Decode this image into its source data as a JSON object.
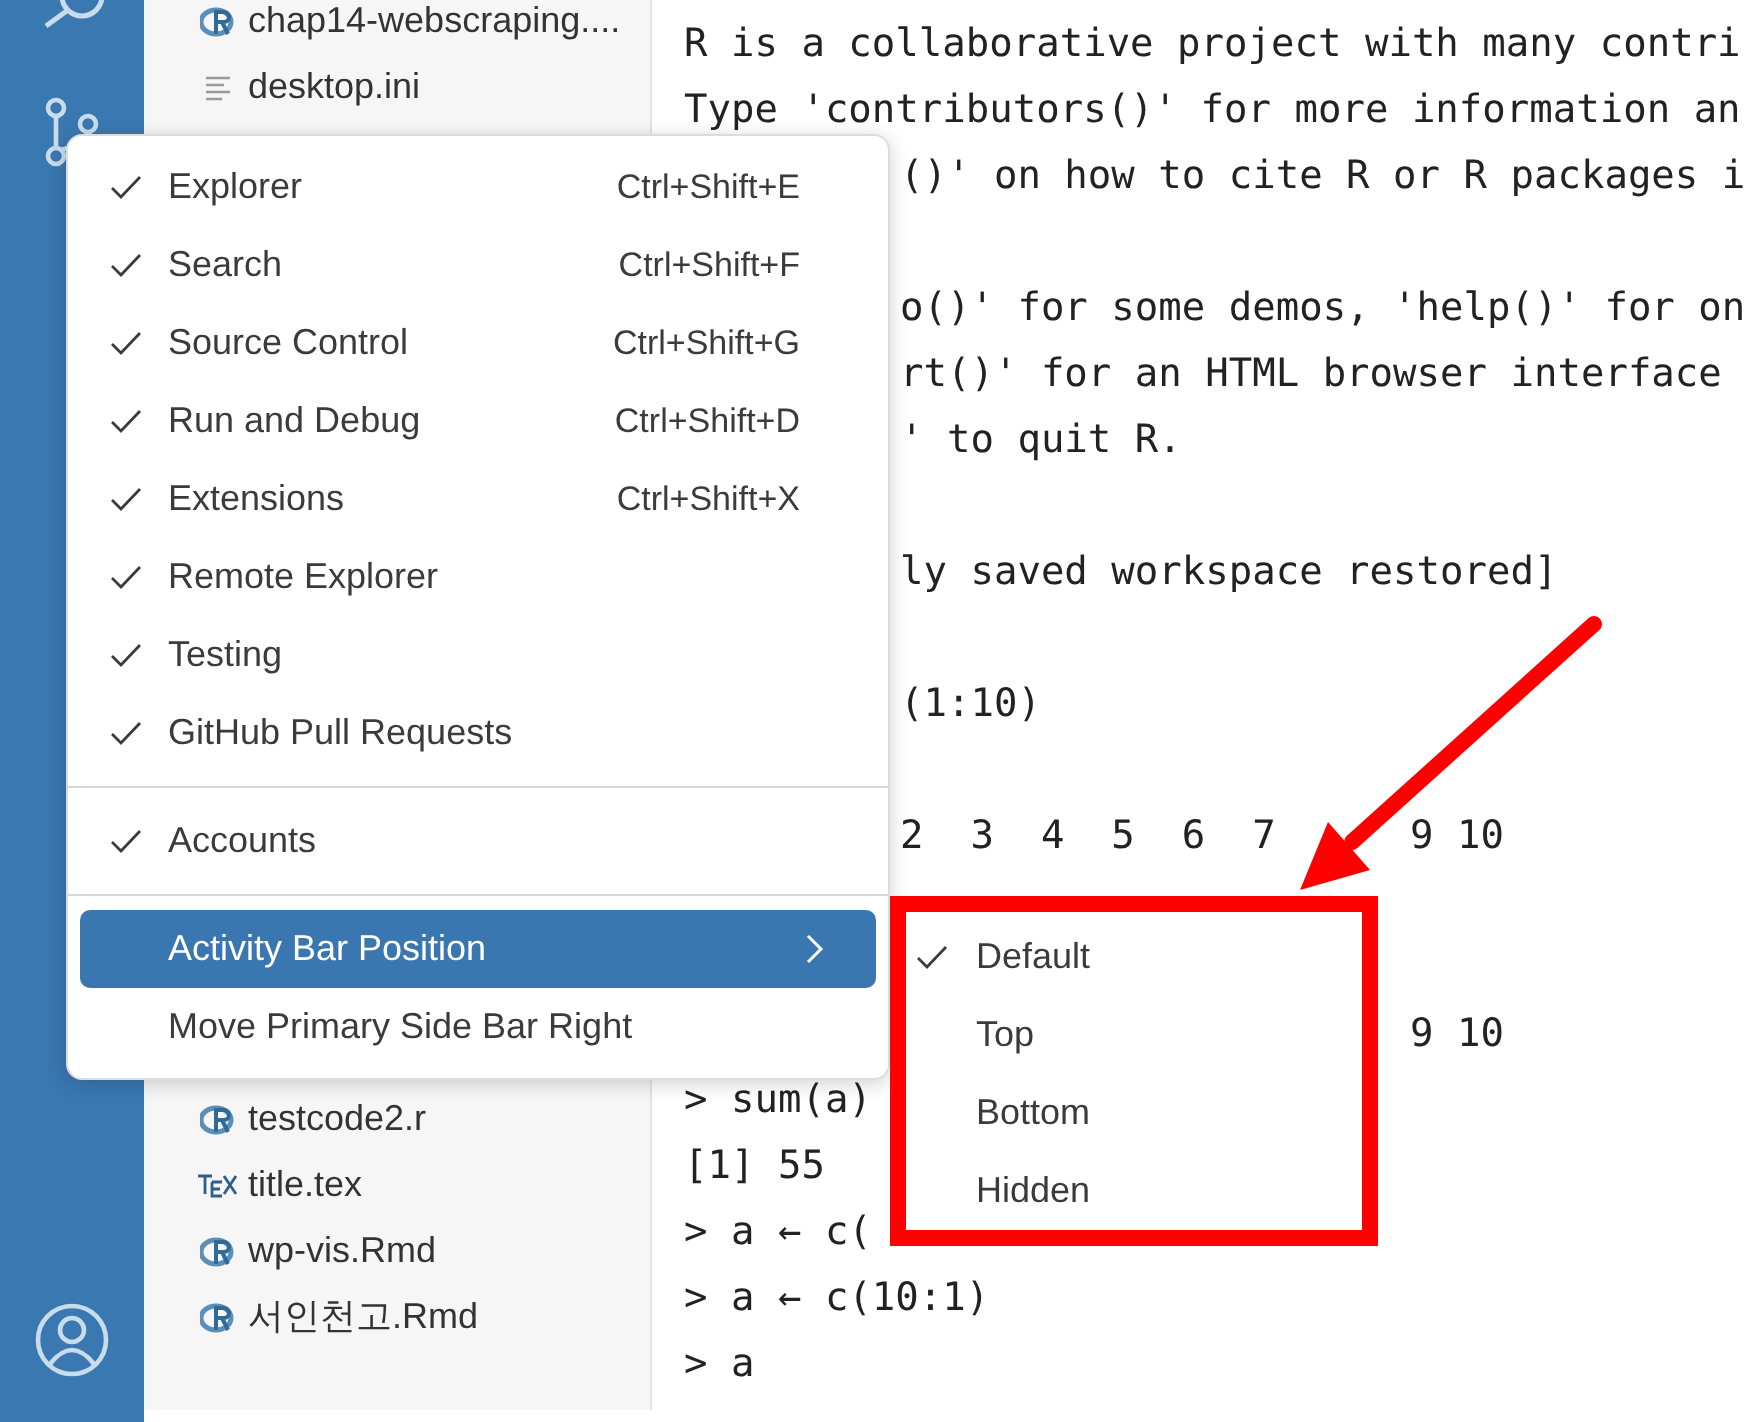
{
  "explorer": {
    "top_files": [
      {
        "name": "chap14-webscraping....",
        "kind": "r"
      },
      {
        "name": "desktop.ini",
        "kind": "text"
      }
    ],
    "bottom_files": [
      {
        "name": "testcode2.r",
        "kind": "r"
      },
      {
        "name": "title.tex",
        "kind": "tex"
      },
      {
        "name": "wp-vis.Rmd",
        "kind": "r"
      },
      {
        "name": "서인천고.Rmd",
        "kind": "r"
      }
    ]
  },
  "terminal": {
    "blocks": [
      [
        {
          "text": "R is a collaborative project with many contri",
          "kind": "full"
        },
        {
          "text": "Type 'contributors()' for more information an",
          "kind": "full"
        },
        {
          "text": "()' on how to cite R or R packages i",
          "kind": "clipped"
        }
      ],
      [
        {
          "text": "o()' for some demos, 'help()' for on",
          "kind": "clipped"
        },
        {
          "text": "rt()' for an HTML browser interface",
          "kind": "clipped"
        },
        {
          "text": "' to quit R.",
          "kind": "clipped"
        }
      ],
      [
        {
          "text": "ly saved workspace restored]",
          "kind": "clipped"
        }
      ],
      [
        {
          "text": "(1:10)",
          "kind": "clipped"
        }
      ],
      [
        {
          "text": "2  3  4  5  6  7",
          "text_right": "9 10",
          "kind": "clipped"
        },
        {
          "text": "9 10",
          "kind": "beside_submenu"
        },
        {
          "text": "> sum(a)",
          "kind": "full"
        },
        {
          "text": "[1] 55",
          "kind": "full"
        },
        {
          "text": "> a ← c(",
          "kind": "full"
        },
        {
          "text": "> a ← c(10:1)",
          "kind": "full"
        },
        {
          "text": "> a",
          "kind": "full"
        }
      ]
    ]
  },
  "context_menu": {
    "groups": [
      [
        {
          "label": "Explorer",
          "shortcut": "Ctrl+Shift+E",
          "checked": true,
          "selected": false
        },
        {
          "label": "Search",
          "shortcut": "Ctrl+Shift+F",
          "checked": true,
          "selected": false
        },
        {
          "label": "Source Control",
          "shortcut": "Ctrl+Shift+G",
          "checked": true,
          "selected": false
        },
        {
          "label": "Run and Debug",
          "shortcut": "Ctrl+Shift+D",
          "checked": true,
          "selected": false
        },
        {
          "label": "Extensions",
          "shortcut": "Ctrl+Shift+X",
          "checked": true,
          "selected": false
        },
        {
          "label": "Remote Explorer",
          "checked": true,
          "selected": false
        },
        {
          "label": "Testing",
          "checked": true,
          "selected": false
        },
        {
          "label": "GitHub Pull Requests",
          "checked": true,
          "selected": false
        }
      ],
      [
        {
          "label": "Accounts",
          "checked": true,
          "selected": false
        }
      ],
      [
        {
          "label": "Activity Bar Position",
          "checked": false,
          "selected": true,
          "has_submenu": true
        },
        {
          "label": "Move Primary Side Bar Right",
          "checked": false,
          "selected": false
        }
      ]
    ]
  },
  "submenu": {
    "items": [
      {
        "label": "Default",
        "checked": true
      },
      {
        "label": "Top",
        "checked": false
      },
      {
        "label": "Bottom",
        "checked": false
      },
      {
        "label": "Hidden",
        "checked": false
      }
    ]
  }
}
